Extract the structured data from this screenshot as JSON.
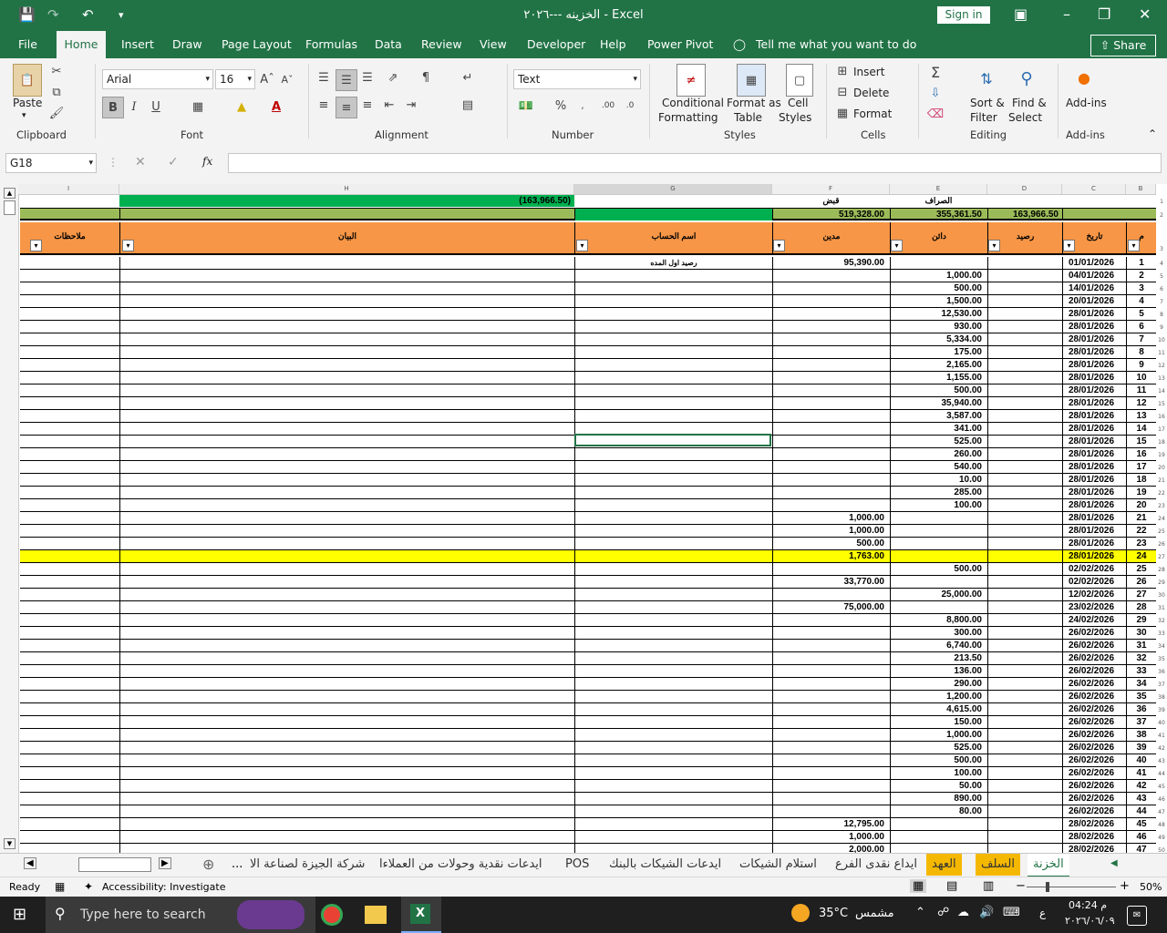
{
  "title_bar": {
    "title": "الخزينه ---٢٠٢٦  -  Excel",
    "sign_in": "Sign in"
  },
  "menu": {
    "items": [
      "File",
      "Home",
      "Insert",
      "Draw",
      "Page Layout",
      "Formulas",
      "Data",
      "Review",
      "View",
      "Developer",
      "Help",
      "Power Pivot"
    ],
    "tell_me": "Tell me what you want to do",
    "share": "Share"
  },
  "ribbon": {
    "clipboard": {
      "paste": "Paste",
      "label": "Clipboard"
    },
    "font": {
      "name": "Arial",
      "size": "16",
      "label": "Font",
      "bold": "B",
      "italic": "I",
      "underline": "U"
    },
    "alignment": {
      "label": "Alignment"
    },
    "number": {
      "format": "Text",
      "label": "Number"
    },
    "styles": {
      "conditional": "Conditional",
      "formatting": "Formatting",
      "format_as": "Format as",
      "table": "Table",
      "cell": "Cell",
      "styles": "Styles",
      "label": "Styles"
    },
    "cells": {
      "insert": "Insert",
      "delete": "Delete",
      "format": "Format",
      "label": "Cells"
    },
    "editing": {
      "sort": "Sort &",
      "filter": "Filter",
      "find": "Find &",
      "select": "Select",
      "label": "Editing"
    },
    "addins": {
      "btn": "Add-ins",
      "label": "Add-ins"
    }
  },
  "formula_bar": {
    "name_box": "G18",
    "fx": "fx",
    "value": ""
  },
  "columns": [
    "I",
    "H",
    "G",
    "F",
    "E",
    "D",
    "C",
    "B"
  ],
  "sheet": {
    "top1": {
      "H": "(163,966.50)",
      "F": "قبض",
      "E": "الصراف"
    },
    "top2": {
      "F": "519,328.00",
      "E": "355,361.50",
      "D": "163,966.50"
    },
    "headers": {
      "I": "ملاحظات",
      "H": "البيان",
      "G": "اسم الحساب",
      "F": "مدين",
      "E": "دائن",
      "D": "رصيد",
      "C": "تاريخ",
      "B": "م"
    },
    "rows": [
      {
        "n": "1",
        "d": "01/01/2026",
        "e": "",
        "f": "95,390.00",
        "g": "رصيد اول المده"
      },
      {
        "n": "2",
        "d": "04/01/2026",
        "e": "1,000.00",
        "f": "",
        "g": ""
      },
      {
        "n": "3",
        "d": "14/01/2026",
        "e": "500.00",
        "f": "",
        "g": ""
      },
      {
        "n": "4",
        "d": "20/01/2026",
        "e": "1,500.00",
        "f": "",
        "g": ""
      },
      {
        "n": "5",
        "d": "28/01/2026",
        "e": "12,530.00",
        "f": "",
        "g": ""
      },
      {
        "n": "6",
        "d": "28/01/2026",
        "e": "930.00",
        "f": "",
        "g": ""
      },
      {
        "n": "7",
        "d": "28/01/2026",
        "e": "5,334.00",
        "f": "",
        "g": ""
      },
      {
        "n": "8",
        "d": "28/01/2026",
        "e": "175.00",
        "f": "",
        "g": ""
      },
      {
        "n": "9",
        "d": "28/01/2026",
        "e": "2,165.00",
        "f": "",
        "g": ""
      },
      {
        "n": "10",
        "d": "28/01/2026",
        "e": "1,155.00",
        "f": "",
        "g": ""
      },
      {
        "n": "11",
        "d": "28/01/2026",
        "e": "500.00",
        "f": "",
        "g": ""
      },
      {
        "n": "12",
        "d": "28/01/2026",
        "e": "35,940.00",
        "f": "",
        "g": ""
      },
      {
        "n": "13",
        "d": "28/01/2026",
        "e": "3,587.00",
        "f": "",
        "g": ""
      },
      {
        "n": "14",
        "d": "28/01/2026",
        "e": "341.00",
        "f": "",
        "g": ""
      },
      {
        "n": "15",
        "d": "28/01/2026",
        "e": "525.00",
        "f": "",
        "g": ""
      },
      {
        "n": "16",
        "d": "28/01/2026",
        "e": "260.00",
        "f": "",
        "g": ""
      },
      {
        "n": "17",
        "d": "28/01/2026",
        "e": "540.00",
        "f": "",
        "g": ""
      },
      {
        "n": "18",
        "d": "28/01/2026",
        "e": "10.00",
        "f": "",
        "g": ""
      },
      {
        "n": "19",
        "d": "28/01/2026",
        "e": "285.00",
        "f": "",
        "g": ""
      },
      {
        "n": "20",
        "d": "28/01/2026",
        "e": "100.00",
        "f": "",
        "g": ""
      },
      {
        "n": "21",
        "d": "28/01/2026",
        "e": "",
        "f": "1,000.00",
        "g": ""
      },
      {
        "n": "22",
        "d": "28/01/2026",
        "e": "",
        "f": "1,000.00",
        "g": ""
      },
      {
        "n": "23",
        "d": "28/01/2026",
        "e": "",
        "f": "500.00",
        "g": ""
      },
      {
        "n": "24",
        "d": "28/01/2026",
        "e": "",
        "f": "1,763.00",
        "g": "",
        "highlight": true
      },
      {
        "n": "25",
        "d": "02/02/2026",
        "e": "500.00",
        "f": "",
        "g": ""
      },
      {
        "n": "26",
        "d": "02/02/2026",
        "e": "",
        "f": "33,770.00",
        "g": ""
      },
      {
        "n": "27",
        "d": "12/02/2026",
        "e": "25,000.00",
        "f": "",
        "g": ""
      },
      {
        "n": "28",
        "d": "23/02/2026",
        "e": "",
        "f": "75,000.00",
        "g": ""
      },
      {
        "n": "29",
        "d": "24/02/2026",
        "e": "8,800.00",
        "f": "",
        "g": ""
      },
      {
        "n": "30",
        "d": "26/02/2026",
        "e": "300.00",
        "f": "",
        "g": ""
      },
      {
        "n": "31",
        "d": "26/02/2026",
        "e": "6,740.00",
        "f": "",
        "g": ""
      },
      {
        "n": "32",
        "d": "26/02/2026",
        "e": "213.50",
        "f": "",
        "g": ""
      },
      {
        "n": "33",
        "d": "26/02/2026",
        "e": "136.00",
        "f": "",
        "g": ""
      },
      {
        "n": "34",
        "d": "26/02/2026",
        "e": "290.00",
        "f": "",
        "g": ""
      },
      {
        "n": "35",
        "d": "26/02/2026",
        "e": "1,200.00",
        "f": "",
        "g": ""
      },
      {
        "n": "36",
        "d": "26/02/2026",
        "e": "4,615.00",
        "f": "",
        "g": ""
      },
      {
        "n": "37",
        "d": "26/02/2026",
        "e": "150.00",
        "f": "",
        "g": ""
      },
      {
        "n": "38",
        "d": "26/02/2026",
        "e": "1,000.00",
        "f": "",
        "g": ""
      },
      {
        "n": "39",
        "d": "26/02/2026",
        "e": "525.00",
        "f": "",
        "g": ""
      },
      {
        "n": "40",
        "d": "26/02/2026",
        "e": "500.00",
        "f": "",
        "g": ""
      },
      {
        "n": "41",
        "d": "26/02/2026",
        "e": "100.00",
        "f": "",
        "g": ""
      },
      {
        "n": "42",
        "d": "26/02/2026",
        "e": "50.00",
        "f": "",
        "g": ""
      },
      {
        "n": "43",
        "d": "26/02/2026",
        "e": "890.00",
        "f": "",
        "g": ""
      },
      {
        "n": "44",
        "d": "26/02/2026",
        "e": "80.00",
        "f": "",
        "g": ""
      },
      {
        "n": "45",
        "d": "28/02/2026",
        "e": "",
        "f": "12,795.00",
        "g": ""
      },
      {
        "n": "46",
        "d": "28/02/2026",
        "e": "",
        "f": "1,000.00",
        "g": ""
      },
      {
        "n": "47",
        "d": "28/02/2026",
        "e": "",
        "f": "2,000.00",
        "g": ""
      }
    ]
  },
  "sheet_tabs": {
    "tabs": [
      "الخزنة",
      "السلف",
      "العهد",
      "ايداع نقدى الفرع",
      "استلام الشيكات",
      "ايدعات الشيكات بالبنك",
      "POS",
      "ايدعات نقدية وحولات من العملاءا",
      "شركة الجيزة لصناعة الا"
    ],
    "more": "..."
  },
  "status": {
    "ready": "Ready",
    "accessibility": "Accessibility: Investigate",
    "zoom": "50%"
  },
  "taskbar": {
    "search": "Type here to search",
    "weather_temp": "35°C",
    "weather_text": "مشمس",
    "lang": "ع",
    "time": "04:24 م",
    "date": "٢٠٢٦/٠٦/٠٩"
  },
  "colors": {
    "excel_green": "#217346",
    "header_orange": "#f79646",
    "top_green": "#00b050",
    "olive": "#9bbb59",
    "highlight": "#ffff00"
  }
}
